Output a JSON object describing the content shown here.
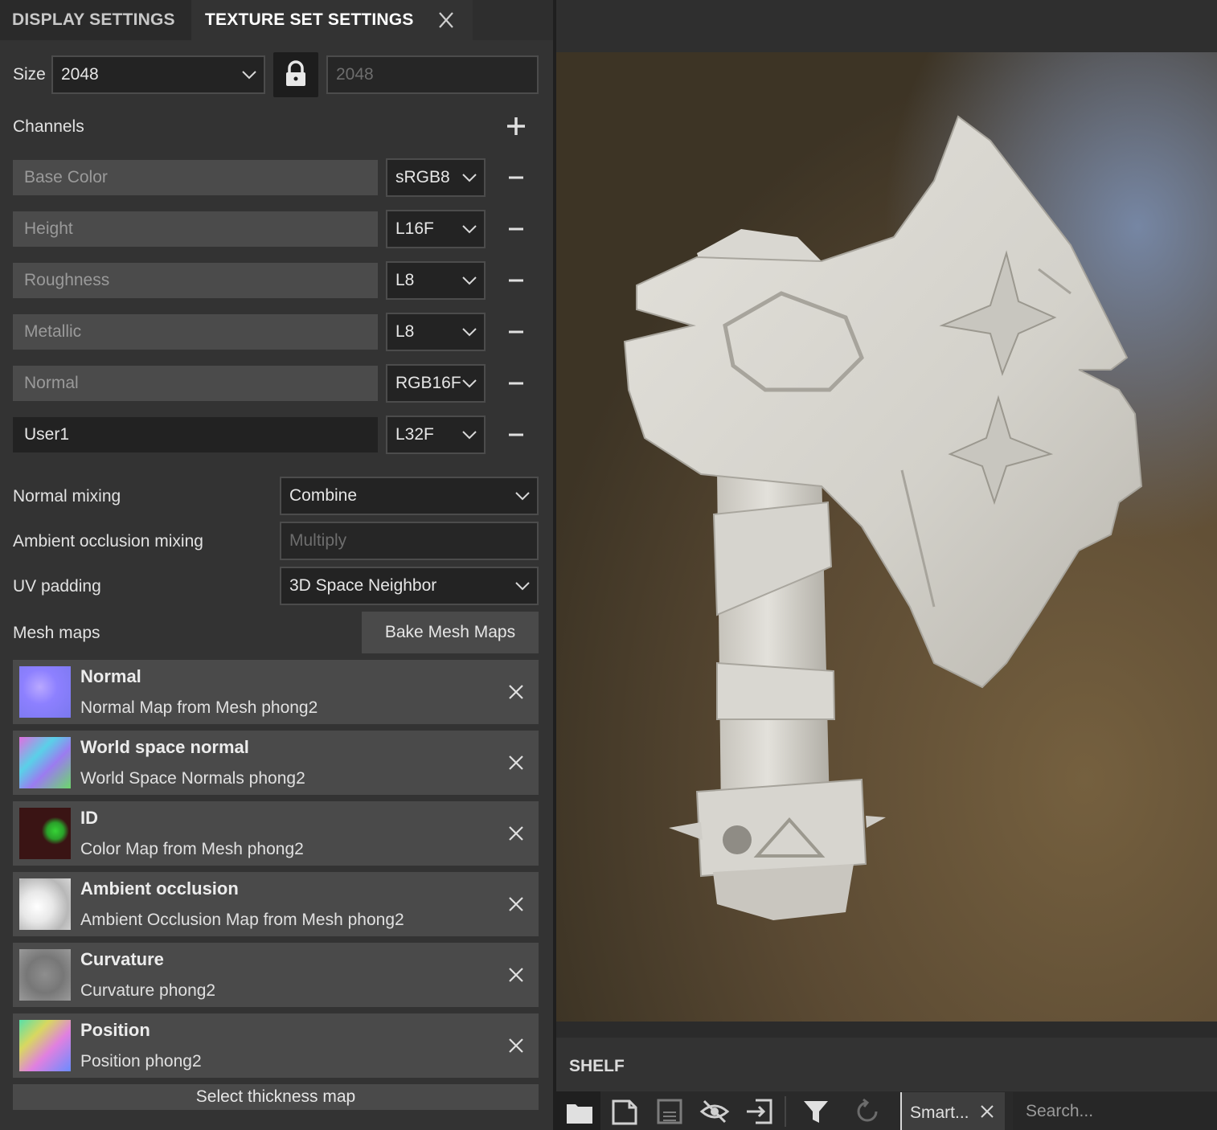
{
  "tabs": {
    "display": "DISPLAY SETTINGS",
    "texture": "TEXTURE SET SETTINGS"
  },
  "size": {
    "label": "Size",
    "value": "2048",
    "linked_value": "2048"
  },
  "channels": {
    "label": "Channels",
    "items": [
      {
        "name": "Base Color",
        "format": "sRGB8"
      },
      {
        "name": "Height",
        "format": "L16F"
      },
      {
        "name": "Roughness",
        "format": "L8"
      },
      {
        "name": "Metallic",
        "format": "L8"
      },
      {
        "name": "Normal",
        "format": "RGB16F"
      },
      {
        "name": "User1",
        "format": "L32F"
      }
    ]
  },
  "mixing": {
    "normal_label": "Normal mixing",
    "normal_value": "Combine",
    "ao_label": "Ambient occlusion mixing",
    "ao_value": "Multiply",
    "uv_label": "UV padding",
    "uv_value": "3D Space Neighbor"
  },
  "mesh_maps": {
    "label": "Mesh maps",
    "bake_button": "Bake Mesh Maps",
    "items": [
      {
        "title": "Normal",
        "subtitle": "Normal Map from Mesh phong2"
      },
      {
        "title": "World space normal",
        "subtitle": "World Space Normals phong2"
      },
      {
        "title": "ID",
        "subtitle": "Color Map from Mesh phong2"
      },
      {
        "title": "Ambient occlusion",
        "subtitle": "Ambient Occlusion Map from Mesh phong2"
      },
      {
        "title": "Curvature",
        "subtitle": "Curvature phong2"
      },
      {
        "title": "Position",
        "subtitle": "Position phong2"
      }
    ],
    "thickness_button": "Select thickness map"
  },
  "shelf": {
    "title": "SHELF",
    "tab_label": "Smart...",
    "search_placeholder": "Search..."
  },
  "icons": {
    "tab_close": "close-icon",
    "lock": "lock-icon",
    "add": "plus-icon",
    "remove": "minus-icon",
    "shelf_tools": [
      "folder-icon",
      "new-file-icon",
      "save-icon",
      "hide-icon",
      "import-icon",
      "filter-icon",
      "refresh-icon"
    ]
  },
  "colors": {
    "panel_bg": "#333333",
    "field_bg": "#232323",
    "row_bg": "#4a4a4a"
  }
}
